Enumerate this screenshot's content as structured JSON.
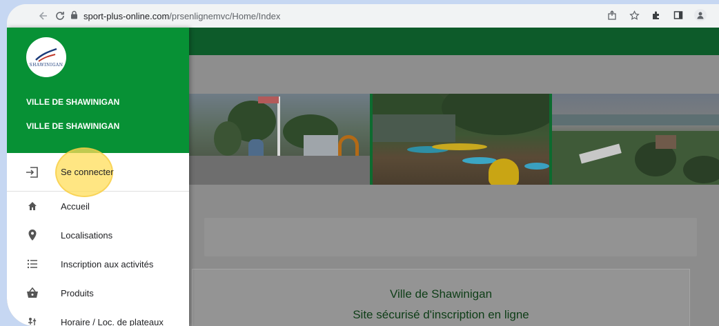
{
  "browser": {
    "url_host": "sport-plus-online.com",
    "url_path": "/prsenlignemvc/Home/Index",
    "icons": [
      "back-arrow-icon",
      "reload-icon",
      "lock-icon",
      "share-icon",
      "star-icon",
      "extensions-icon",
      "sidepanel-icon",
      "profile-icon"
    ]
  },
  "drawer": {
    "org_name_1": "VILLE DE SHAWINIGAN",
    "org_name_2": "VILLE DE SHAWINIGAN",
    "logo_text": "SHAWINIGAN",
    "menu": [
      {
        "label": "Se connecter",
        "icon": "login-icon"
      },
      {
        "label": "Accueil",
        "icon": "home-icon"
      },
      {
        "label": "Localisations",
        "icon": "location-pin-icon"
      },
      {
        "label": "Inscription aux activités",
        "icon": "list-icon"
      },
      {
        "label": "Produits",
        "icon": "basket-icon"
      },
      {
        "label": "Horaire / Loc. de plateaux",
        "icon": "schedule-icon"
      }
    ]
  },
  "content": {
    "title": "Ville de Shawinigan",
    "subtitle": "Site sécurisé d'inscription en ligne"
  },
  "colors": {
    "brand_green": "#079135",
    "header_dark_green": "#0d5b2a",
    "highlight_yellow": "#ffde5a"
  }
}
